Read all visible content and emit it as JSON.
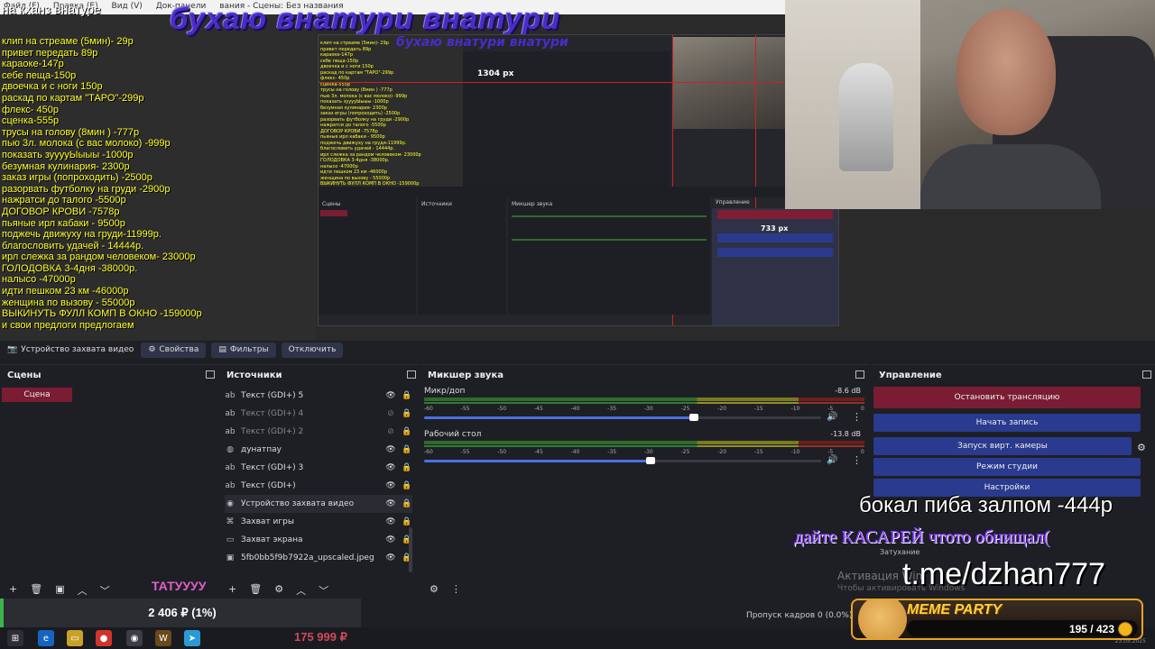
{
  "preview": {
    "menubar": [
      "Файл (F)",
      "Правка (E)",
      "Вид (V)",
      "Док-панели"
    ],
    "window_title": "вания - Сцены: Без названия",
    "price_header": "на кханз внатурe",
    "overlay_title": "бухаю внатури внатури",
    "price_list": [
      "клип на стреаме (5мин)- 29р",
      "привет передать 89р",
      "караоке-147р",
      "себе пеща-150р",
      "двоечка и с ноги 150р",
      "раскад по картам \"ТАРО\"-299р",
      "флекс- 450р",
      "сценка-555р",
      "трусы на голову (8мин ) -777р",
      "пью 3л. молока (с вас молоко) -999р",
      "показать зууууЫыыы -1000р",
      "безумная кулинария- 2300р",
      "заказ игры (попроходить) -2500р",
      "разорвать футболку на груди -2900р",
      "нажратси до талого -5500р",
      "ДОГОВОР КРОВИ -7578р",
      "пьяные ирл кабаки - 9500р",
      "поджечь движуху на груди-11999р.",
      "благословить удачей - 14444р.",
      "ирл слежка за рандом человеком- 23000р",
      "ГОЛОДОВКА 3-4дня -38000р.",
      "налысо -47000р",
      "идти пешком 23 км -46000р",
      "женщина по вызову - 55000р",
      "ВЫКИНУТЬ ФУЛЛ КОМП В ОКНО -159000р",
      "и свои предлоги предлогаем"
    ],
    "nested": {
      "label_px_1": "1304 px",
      "label_px_2": "733 px",
      "scenes": "Сцены",
      "sources": "Источники",
      "mixer": "Микшер звука",
      "controls": "Управление"
    }
  },
  "props_bar": {
    "device_label": "Устройство захвата видео",
    "properties": "Свойства",
    "filters": "Фильтры",
    "deactivate": "Отключить"
  },
  "scenes": {
    "title": "Сцены",
    "items": [
      "Сцена"
    ]
  },
  "sources": {
    "title": "Источники",
    "items": [
      {
        "label": "Текст (GDI+) 5",
        "icon": "text-icon",
        "visible": true
      },
      {
        "label": "Текст (GDI+) 4",
        "icon": "text-icon",
        "visible": false
      },
      {
        "label": "Текст (GDI+) 2",
        "icon": "text-icon",
        "visible": false
      },
      {
        "label": "дунатпау",
        "icon": "browser-icon",
        "visible": true
      },
      {
        "label": "Текст (GDI+) 3",
        "icon": "text-icon",
        "visible": true
      },
      {
        "label": "Текст (GDI+)",
        "icon": "text-icon",
        "visible": true
      },
      {
        "label": "Устройство захвата видео",
        "icon": "camera-icon",
        "visible": true
      },
      {
        "label": "Захват игры",
        "icon": "gamepad-icon",
        "visible": true
      },
      {
        "label": "Захват экрана",
        "icon": "monitor-icon",
        "visible": true
      },
      {
        "label": "5fb0bb5f9b7922a_upscaled.jpeg",
        "icon": "image-icon",
        "visible": true
      }
    ]
  },
  "mixer": {
    "title": "Микшер звука",
    "scale": [
      "-60",
      "-55",
      "-50",
      "-45",
      "-40",
      "-35",
      "-30",
      "-25",
      "-20",
      "-15",
      "-10",
      "-5",
      "0"
    ],
    "tracks": [
      {
        "name": "Микр/доп",
        "db": "-8.6 dB",
        "volume": 0.68
      },
      {
        "name": "Рабочий стол",
        "db": "-13.8 dB",
        "volume": 0.57
      }
    ]
  },
  "controls": {
    "title": "Управление",
    "stop_stream": "Остановить трансляцию",
    "start_recording": "Начать запись",
    "start_virtual_cam": "Запуск вирт. камеры",
    "studio_mode": "Режим студии",
    "settings": "Настройки"
  },
  "overlays": {
    "beer": "бокал пиба залпом -444р",
    "kasarei": "дайте КАСАРЕЙ чтото обнищал(",
    "tme": "t.me/dzhan777",
    "tattoo": "ТАТУУУУ",
    "activate": "Активация Win",
    "activate2": "Чтобы активировать Windows",
    "fade": "Затухание"
  },
  "donation": {
    "amount": "2 406 ₽ (1%)",
    "goal": "175 999 ₽"
  },
  "meme_widget": {
    "title": "MEME PARTY",
    "count": "195 / 423"
  },
  "status": {
    "dropped_frames": "Пропуск кадров 0 (0.0%)"
  },
  "taskbar": {
    "date": "23.05.2025"
  },
  "colors": {
    "accent_red": "#7a1d33",
    "accent_blue": "#2a3a8e",
    "price_yellow": "#ffff26",
    "title_purple": "#4b2cc8"
  }
}
